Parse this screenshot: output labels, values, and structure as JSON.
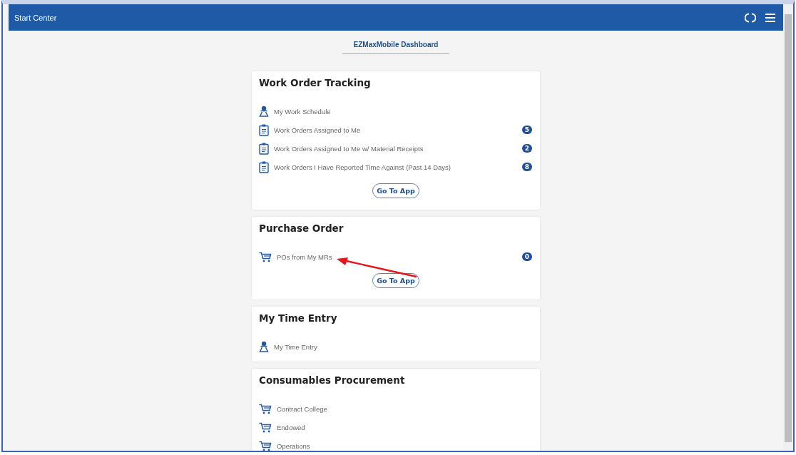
{
  "header": {
    "title": "Start Center"
  },
  "tabs": [
    {
      "label": "EZMaxMobile Dashboard",
      "selected": true
    }
  ],
  "cards": [
    {
      "title": "Work Order Tracking",
      "items": [
        {
          "kind": "person",
          "label": "My Work Schedule"
        },
        {
          "kind": "clipboard",
          "label": "Work Orders Assigned to Me",
          "count": "5"
        },
        {
          "kind": "clipboard",
          "label": "Work Orders Assigned to Me w/ Material Receipts",
          "count": "2"
        },
        {
          "kind": "clipboard",
          "label": "Work Orders I Have Reported Time Against (Past 14 Days)",
          "count": "8"
        }
      ],
      "button": "Go To App"
    },
    {
      "title": "Purchase Order",
      "items": [
        {
          "kind": "cart",
          "label": "POs from My MRs",
          "count": "0"
        }
      ],
      "button": "Go To App"
    },
    {
      "title": "My Time Entry",
      "items": [
        {
          "kind": "person",
          "label": "My Time Entry"
        }
      ]
    },
    {
      "title": "Consumables Procurement",
      "items": [
        {
          "kind": "cart",
          "label": "Contract College"
        },
        {
          "kind": "cart",
          "label": "Endowed"
        },
        {
          "kind": "cart",
          "label": "Operations"
        }
      ]
    }
  ]
}
